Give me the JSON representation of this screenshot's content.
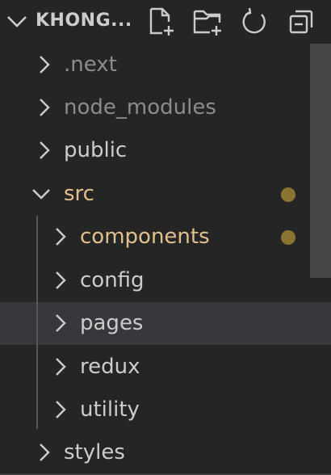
{
  "header": {
    "title": "KHONG...",
    "icons": [
      "chevron-down-icon",
      "new-file-icon",
      "new-folder-icon",
      "refresh-icon",
      "collapse-all-icon"
    ]
  },
  "colors": {
    "default_text": "#cccccc",
    "dimmed_text": "#8c8c8c",
    "modified_text": "#e2c08d",
    "modified_dot": "#8a7530",
    "selected_bg": "#37373d",
    "background": "#252526"
  },
  "tree": [
    {
      "label": ".next",
      "depth": 0,
      "expanded": false,
      "state": "dimmed"
    },
    {
      "label": "node_modules",
      "depth": 0,
      "expanded": false,
      "state": "dimmed"
    },
    {
      "label": "public",
      "depth": 0,
      "expanded": false,
      "state": "normal"
    },
    {
      "label": "src",
      "depth": 0,
      "expanded": true,
      "state": "modified"
    },
    {
      "label": "components",
      "depth": 1,
      "expanded": false,
      "state": "modified"
    },
    {
      "label": "config",
      "depth": 1,
      "expanded": false,
      "state": "normal"
    },
    {
      "label": "pages",
      "depth": 1,
      "expanded": false,
      "state": "normal",
      "selected": true
    },
    {
      "label": "redux",
      "depth": 1,
      "expanded": false,
      "state": "normal"
    },
    {
      "label": "utility",
      "depth": 1,
      "expanded": false,
      "state": "normal"
    },
    {
      "label": "styles",
      "depth": 0,
      "expanded": false,
      "state": "normal"
    }
  ]
}
